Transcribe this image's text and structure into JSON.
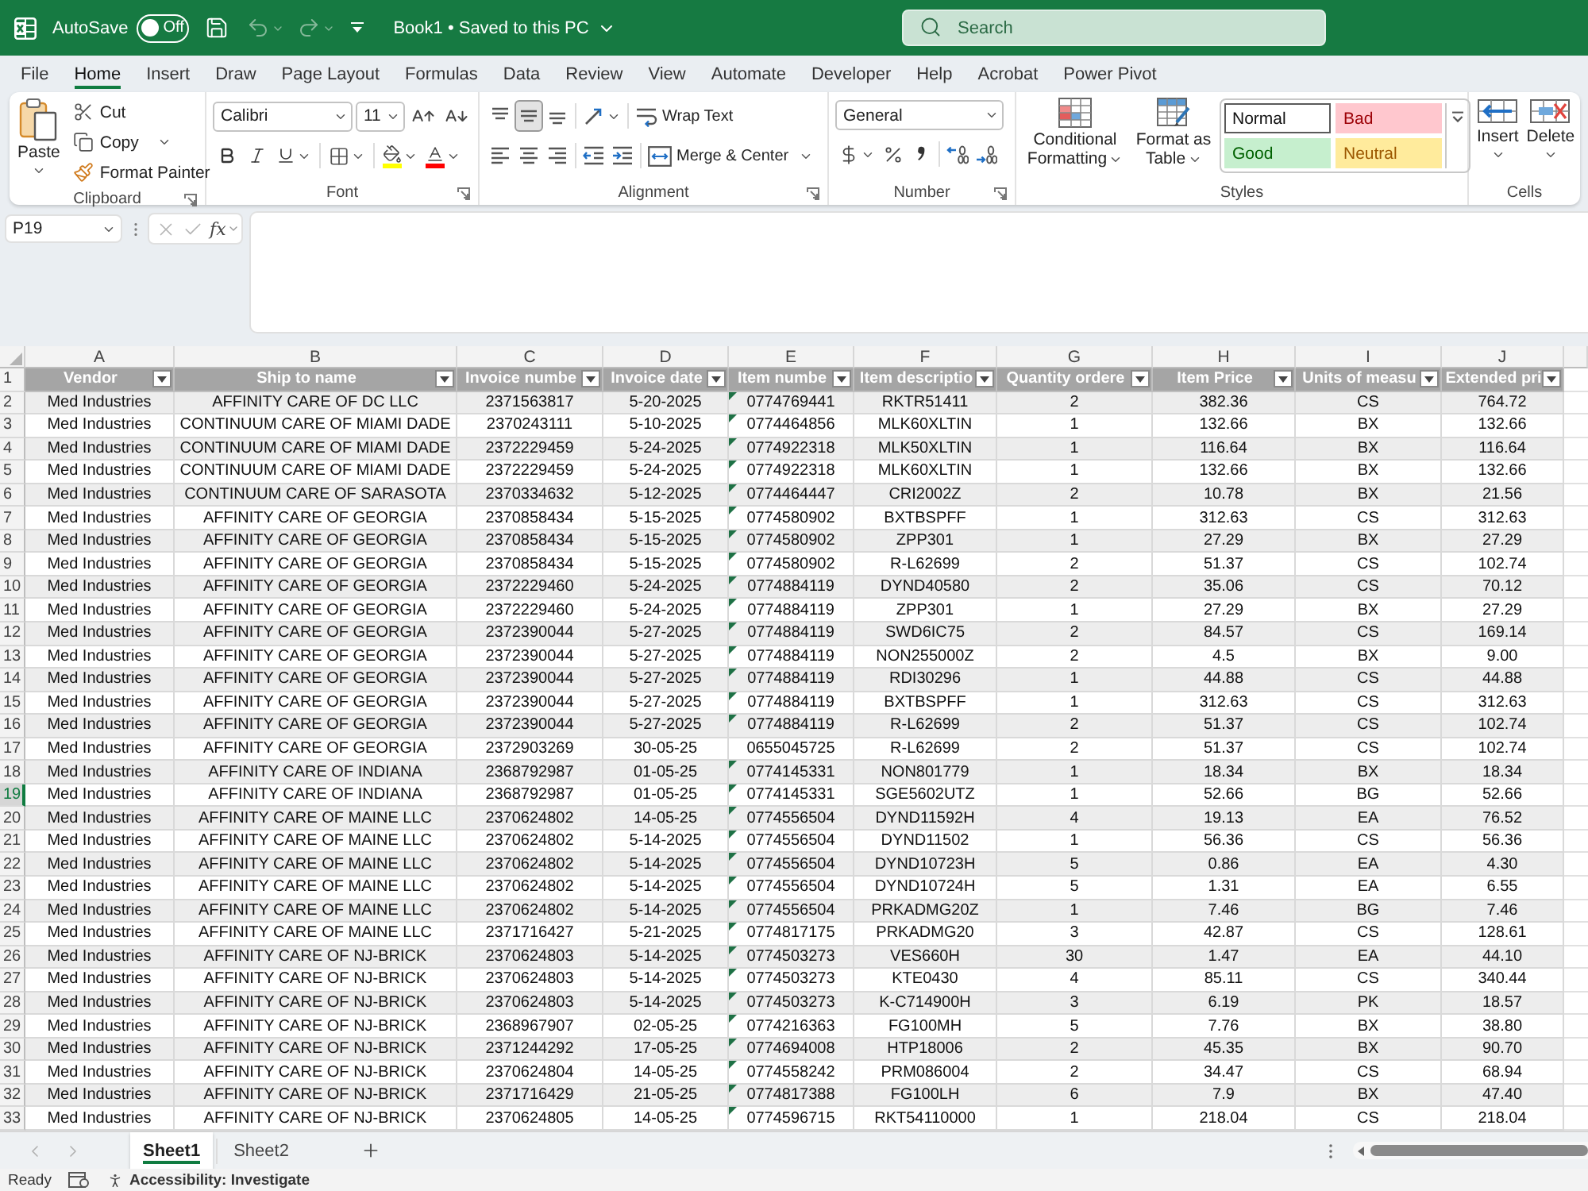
{
  "title_bar": {
    "autosave": {
      "label": "AutoSave",
      "on": false,
      "state_label": "Off"
    },
    "undo_disabled": true,
    "redo_disabled": true,
    "document_title": "Book1 • Saved to this PC",
    "search": {
      "placeholder": "Search"
    }
  },
  "menu_tabs": [
    {
      "label": "File",
      "selected": false
    },
    {
      "label": "Home",
      "selected": true
    },
    {
      "label": "Insert",
      "selected": false
    },
    {
      "label": "Draw",
      "selected": false
    },
    {
      "label": "Page Layout",
      "selected": false
    },
    {
      "label": "Formulas",
      "selected": false
    },
    {
      "label": "Data",
      "selected": false
    },
    {
      "label": "Review",
      "selected": false
    },
    {
      "label": "View",
      "selected": false
    },
    {
      "label": "Automate",
      "selected": false
    },
    {
      "label": "Developer",
      "selected": false
    },
    {
      "label": "Help",
      "selected": false
    },
    {
      "label": "Acrobat",
      "selected": false
    },
    {
      "label": "Power Pivot",
      "selected": false
    }
  ],
  "ribbon": {
    "clipboard": {
      "label": "Clipboard",
      "paste": "Paste",
      "cut": "Cut",
      "copy": "Copy",
      "format_painter": "Format Painter"
    },
    "font": {
      "label": "Font",
      "font_name": "Calibri",
      "font_size": "11",
      "color_buttons": [
        {
          "kind": "fill",
          "color": "#ffff00"
        },
        {
          "kind": "font",
          "color": "#ff0000"
        }
      ]
    },
    "alignment": {
      "label": "Alignment",
      "vertical": [
        {
          "kind": "top",
          "selected": false
        },
        {
          "kind": "middle",
          "selected": true
        },
        {
          "kind": "bottom",
          "selected": false
        }
      ],
      "horizontal": [
        {
          "kind": "left",
          "selected": false
        },
        {
          "kind": "center",
          "selected": false
        },
        {
          "kind": "right",
          "selected": false
        }
      ],
      "wrap_text": "Wrap Text",
      "merge_center": "Merge & Center"
    },
    "number": {
      "label": "Number",
      "format": "General"
    },
    "styles": {
      "label": "Styles",
      "conditional_formatting": "Conditional Formatting",
      "format_as_table": "Format as Table",
      "gallery": [
        {
          "label": "Normal",
          "kind": "normal",
          "selected": true
        },
        {
          "label": "Bad",
          "kind": "bad",
          "selected": false
        },
        {
          "label": "Good",
          "kind": "good",
          "selected": false
        },
        {
          "label": "Neutral",
          "kind": "neutral",
          "selected": false
        }
      ]
    },
    "cells": {
      "label": "Cells",
      "insert": "Insert",
      "delete": "Delete"
    }
  },
  "formula_bar": {
    "name_box": "P19",
    "cancel_disabled": true,
    "enter_disabled": true,
    "function_label": "fx"
  },
  "sheet": {
    "columns": [
      {
        "letter": "A",
        "title": "Vendor"
      },
      {
        "letter": "B",
        "title": "Ship to name"
      },
      {
        "letter": "C",
        "title": "Invoice numbe"
      },
      {
        "letter": "D",
        "title": "Invoice date"
      },
      {
        "letter": "E",
        "title": "Item numbe"
      },
      {
        "letter": "F",
        "title": "Item descriptio"
      },
      {
        "letter": "G",
        "title": "Quantity ordere"
      },
      {
        "letter": "H",
        "title": "Item Price"
      },
      {
        "letter": "I",
        "title": "Units of measu"
      },
      {
        "letter": "J",
        "title": "Extended pri"
      }
    ],
    "header_row_number": "1",
    "rows": [
      {
        "number": "2",
        "selected": false,
        "flagged": true,
        "cells": [
          "Med Industries",
          "AFFINITY CARE OF DC LLC",
          "2371563817",
          "5-20-2025",
          "0774769441",
          "RKTR51411",
          "2",
          "382.36",
          "CS",
          "764.72"
        ]
      },
      {
        "number": "3",
        "selected": false,
        "flagged": true,
        "cells": [
          "Med Industries",
          "CONTINUUM CARE OF MIAMI DADE",
          "2370243111",
          "5-10-2025",
          "0774464856",
          "MLK60XLTIN",
          "1",
          "132.66",
          "BX",
          "132.66"
        ]
      },
      {
        "number": "4",
        "selected": false,
        "flagged": true,
        "cells": [
          "Med Industries",
          "CONTINUUM CARE OF MIAMI DADE",
          "2372229459",
          "5-24-2025",
          "0774922318",
          "MLK50XLTIN",
          "1",
          "116.64",
          "BX",
          "116.64"
        ]
      },
      {
        "number": "5",
        "selected": false,
        "flagged": true,
        "cells": [
          "Med Industries",
          "CONTINUUM CARE OF MIAMI DADE",
          "2372229459",
          "5-24-2025",
          "0774922318",
          "MLK60XLTIN",
          "1",
          "132.66",
          "BX",
          "132.66"
        ]
      },
      {
        "number": "6",
        "selected": false,
        "flagged": true,
        "cells": [
          "Med Industries",
          "CONTINUUM CARE OF SARASOTA",
          "2370334632",
          "5-12-2025",
          "0774464447",
          "CRI2002Z",
          "2",
          "10.78",
          "BX",
          "21.56"
        ]
      },
      {
        "number": "7",
        "selected": false,
        "flagged": true,
        "cells": [
          "Med Industries",
          "AFFINITY CARE OF GEORGIA",
          "2370858434",
          "5-15-2025",
          "0774580902",
          "BXTBSPFF",
          "1",
          "312.63",
          "CS",
          "312.63"
        ]
      },
      {
        "number": "8",
        "selected": false,
        "flagged": true,
        "cells": [
          "Med Industries",
          "AFFINITY CARE OF GEORGIA",
          "2370858434",
          "5-15-2025",
          "0774580902",
          "ZPP301",
          "1",
          "27.29",
          "BX",
          "27.29"
        ]
      },
      {
        "number": "9",
        "selected": false,
        "flagged": true,
        "cells": [
          "Med Industries",
          "AFFINITY CARE OF GEORGIA",
          "2370858434",
          "5-15-2025",
          "0774580902",
          "R-L62699",
          "2",
          "51.37",
          "CS",
          "102.74"
        ]
      },
      {
        "number": "10",
        "selected": false,
        "flagged": true,
        "cells": [
          "Med Industries",
          "AFFINITY CARE OF GEORGIA",
          "2372229460",
          "5-24-2025",
          "0774884119",
          "DYND40580",
          "2",
          "35.06",
          "CS",
          "70.12"
        ]
      },
      {
        "number": "11",
        "selected": false,
        "flagged": true,
        "cells": [
          "Med Industries",
          "AFFINITY CARE OF GEORGIA",
          "2372229460",
          "5-24-2025",
          "0774884119",
          "ZPP301",
          "1",
          "27.29",
          "BX",
          "27.29"
        ]
      },
      {
        "number": "12",
        "selected": false,
        "flagged": true,
        "cells": [
          "Med Industries",
          "AFFINITY CARE OF GEORGIA",
          "2372390044",
          "5-27-2025",
          "0774884119",
          "SWD6IC75",
          "2",
          "84.57",
          "CS",
          "169.14"
        ]
      },
      {
        "number": "13",
        "selected": false,
        "flagged": true,
        "cells": [
          "Med Industries",
          "AFFINITY CARE OF GEORGIA",
          "2372390044",
          "5-27-2025",
          "0774884119",
          "NON255000Z",
          "2",
          "4.5",
          "BX",
          "9.00"
        ]
      },
      {
        "number": "14",
        "selected": false,
        "flagged": true,
        "cells": [
          "Med Industries",
          "AFFINITY CARE OF GEORGIA",
          "2372390044",
          "5-27-2025",
          "0774884119",
          "RDI30296",
          "1",
          "44.88",
          "CS",
          "44.88"
        ]
      },
      {
        "number": "15",
        "selected": false,
        "flagged": true,
        "cells": [
          "Med Industries",
          "AFFINITY CARE OF GEORGIA",
          "2372390044",
          "5-27-2025",
          "0774884119",
          "BXTBSPFF",
          "1",
          "312.63",
          "CS",
          "312.63"
        ]
      },
      {
        "number": "16",
        "selected": false,
        "flagged": true,
        "cells": [
          "Med Industries",
          "AFFINITY CARE OF GEORGIA",
          "2372390044",
          "5-27-2025",
          "0774884119",
          "R-L62699",
          "2",
          "51.37",
          "CS",
          "102.74"
        ]
      },
      {
        "number": "17",
        "selected": false,
        "flagged": false,
        "cells": [
          "Med Industries",
          "AFFINITY CARE OF GEORGIA",
          "2372903269",
          "30-05-25",
          "0655045725",
          "R-L62699",
          "2",
          "51.37",
          "CS",
          "102.74"
        ]
      },
      {
        "number": "18",
        "selected": false,
        "flagged": true,
        "cells": [
          "Med Industries",
          "AFFINITY CARE OF INDIANA",
          "2368792987",
          "01-05-25",
          "0774145331",
          "NON801779",
          "1",
          "18.34",
          "BX",
          "18.34"
        ]
      },
      {
        "number": "19",
        "selected": true,
        "flagged": true,
        "cells": [
          "Med Industries",
          "AFFINITY CARE OF INDIANA",
          "2368792987",
          "01-05-25",
          "0774145331",
          "SGE5602UTZ",
          "1",
          "52.66",
          "BG",
          "52.66"
        ]
      },
      {
        "number": "20",
        "selected": false,
        "flagged": true,
        "cells": [
          "Med Industries",
          "AFFINITY CARE OF MAINE LLC",
          "2370624802",
          "14-05-25",
          "0774556504",
          "DYND11592H",
          "4",
          "19.13",
          "EA",
          "76.52"
        ]
      },
      {
        "number": "21",
        "selected": false,
        "flagged": true,
        "cells": [
          "Med Industries",
          "AFFINITY CARE OF MAINE LLC",
          "2370624802",
          "5-14-2025",
          "0774556504",
          "DYND11502",
          "1",
          "56.36",
          "CS",
          "56.36"
        ]
      },
      {
        "number": "22",
        "selected": false,
        "flagged": true,
        "cells": [
          "Med Industries",
          "AFFINITY CARE OF MAINE LLC",
          "2370624802",
          "5-14-2025",
          "0774556504",
          "DYND10723H",
          "5",
          "0.86",
          "EA",
          "4.30"
        ]
      },
      {
        "number": "23",
        "selected": false,
        "flagged": true,
        "cells": [
          "Med Industries",
          "AFFINITY CARE OF MAINE LLC",
          "2370624802",
          "5-14-2025",
          "0774556504",
          "DYND10724H",
          "5",
          "1.31",
          "EA",
          "6.55"
        ]
      },
      {
        "number": "24",
        "selected": false,
        "flagged": true,
        "cells": [
          "Med Industries",
          "AFFINITY CARE OF MAINE LLC",
          "2370624802",
          "5-14-2025",
          "0774556504",
          "PRKADMG20Z",
          "1",
          "7.46",
          "BG",
          "7.46"
        ]
      },
      {
        "number": "25",
        "selected": false,
        "flagged": true,
        "cells": [
          "Med Industries",
          "AFFINITY CARE OF MAINE LLC",
          "2371716427",
          "5-21-2025",
          "0774817175",
          "PRKADMG20",
          "3",
          "42.87",
          "CS",
          "128.61"
        ]
      },
      {
        "number": "26",
        "selected": false,
        "flagged": true,
        "cells": [
          "Med Industries",
          "AFFINITY CARE OF NJ-BRICK",
          "2370624803",
          "5-14-2025",
          "0774503273",
          "VES660H",
          "30",
          "1.47",
          "EA",
          "44.10"
        ]
      },
      {
        "number": "27",
        "selected": false,
        "flagged": true,
        "cells": [
          "Med Industries",
          "AFFINITY CARE OF NJ-BRICK",
          "2370624803",
          "5-14-2025",
          "0774503273",
          "KTE0430",
          "4",
          "85.11",
          "CS",
          "340.44"
        ]
      },
      {
        "number": "28",
        "selected": false,
        "flagged": true,
        "cells": [
          "Med Industries",
          "AFFINITY CARE OF NJ-BRICK",
          "2370624803",
          "5-14-2025",
          "0774503273",
          "K-C714900H",
          "3",
          "6.19",
          "PK",
          "18.57"
        ]
      },
      {
        "number": "29",
        "selected": false,
        "flagged": true,
        "cells": [
          "Med Industries",
          "AFFINITY CARE OF NJ-BRICK",
          "2368967907",
          "02-05-25",
          "0774216363",
          "FG100MH",
          "5",
          "7.76",
          "BX",
          "38.80"
        ]
      },
      {
        "number": "30",
        "selected": false,
        "flagged": true,
        "cells": [
          "Med Industries",
          "AFFINITY CARE OF NJ-BRICK",
          "2371244292",
          "17-05-25",
          "0774694008",
          "HTP18006",
          "2",
          "45.35",
          "BX",
          "90.70"
        ]
      },
      {
        "number": "31",
        "selected": false,
        "flagged": true,
        "cells": [
          "Med Industries",
          "AFFINITY CARE OF NJ-BRICK",
          "2370624804",
          "14-05-25",
          "0774558242",
          "PRM086004",
          "2",
          "34.47",
          "CS",
          "68.94"
        ]
      },
      {
        "number": "32",
        "selected": false,
        "flagged": true,
        "cells": [
          "Med Industries",
          "AFFINITY CARE OF NJ-BRICK",
          "2371716429",
          "21-05-25",
          "0774817388",
          "FG100LH",
          "6",
          "7.9",
          "BX",
          "47.40"
        ]
      },
      {
        "number": "33",
        "selected": false,
        "flagged": true,
        "cells": [
          "Med Industries",
          "AFFINITY CARE OF NJ-BRICK",
          "2370624805",
          "14-05-25",
          "0774596715",
          "RKT54110000",
          "1",
          "218.04",
          "CS",
          "218.04"
        ]
      }
    ]
  },
  "sheet_tabs": {
    "prev_disabled": true,
    "next_disabled": true,
    "tabs": [
      {
        "label": "Sheet1",
        "selected": true
      },
      {
        "label": "Sheet2",
        "selected": false
      }
    ]
  },
  "status_bar": {
    "mode": "Ready",
    "accessibility": "Accessibility: Investigate"
  }
}
